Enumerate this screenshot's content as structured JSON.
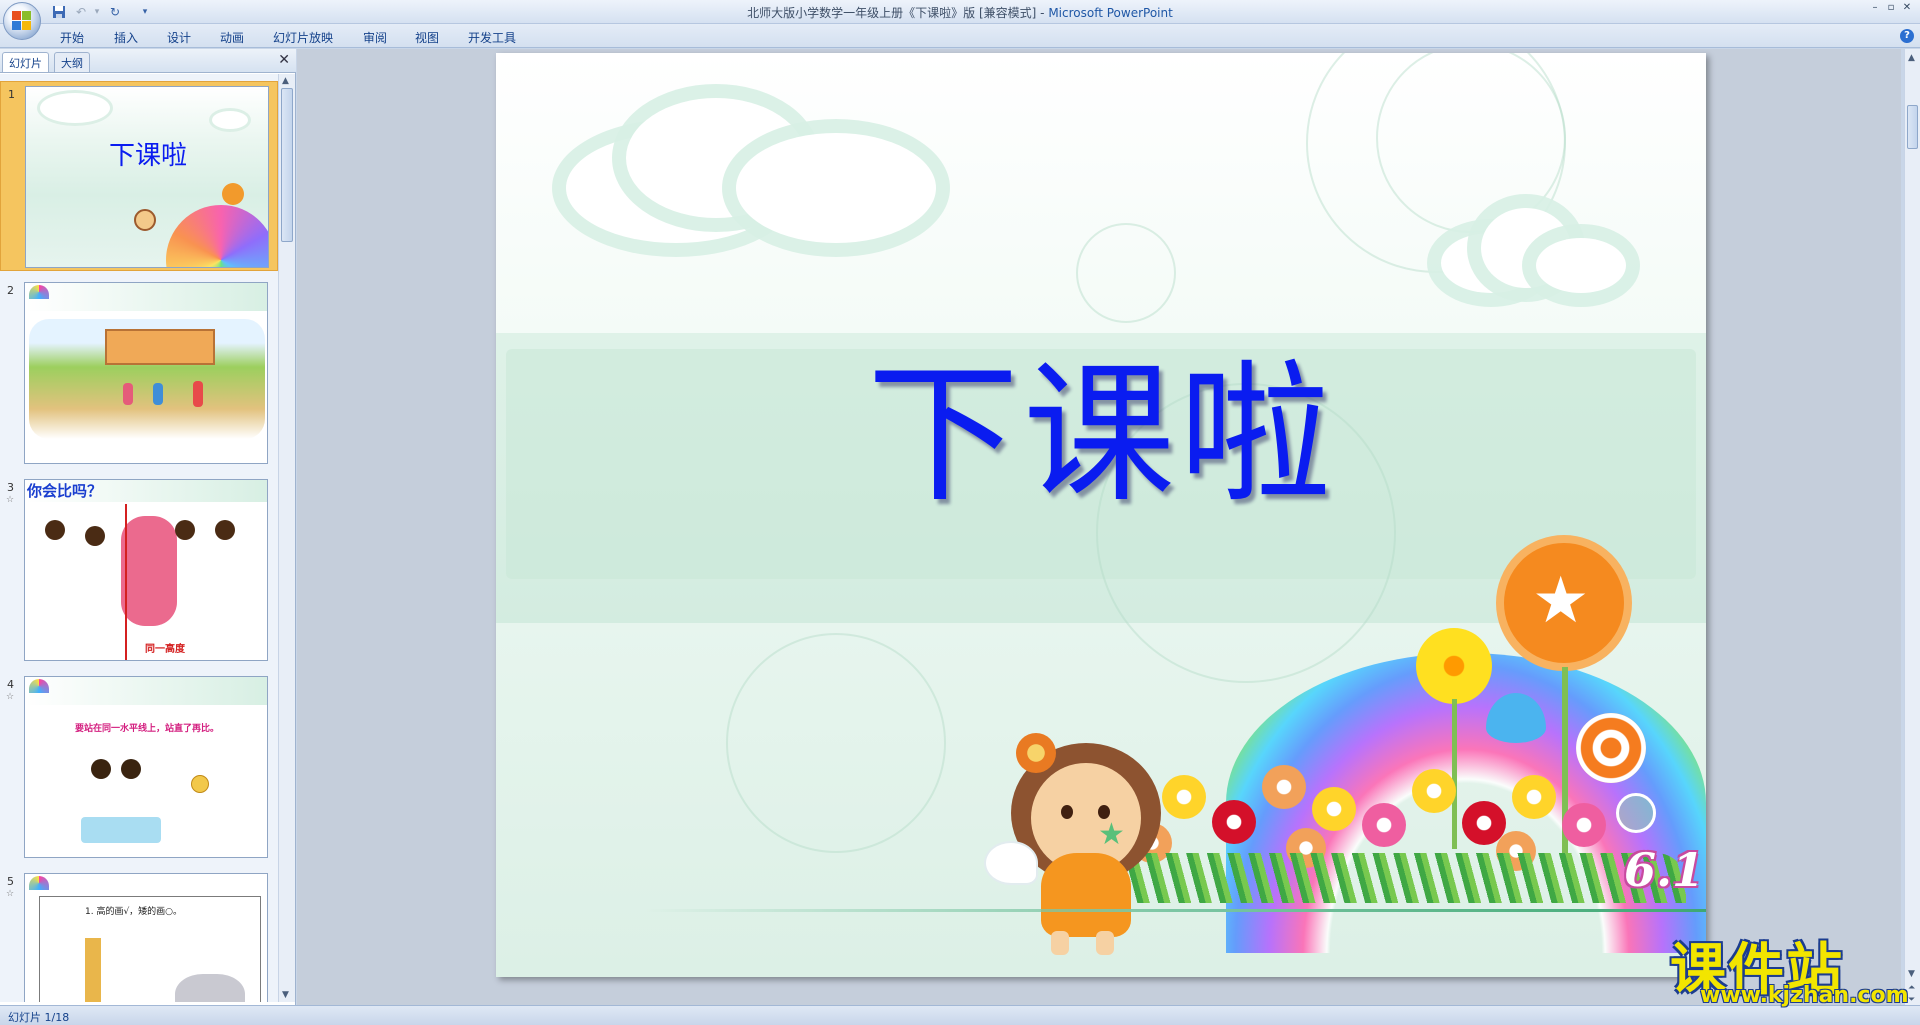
{
  "window": {
    "title_prefix": "北师大版小学数学一年级上册《下课啦》版 [兼容模式] - ",
    "title_app": "Microsoft PowerPoint"
  },
  "ribbon": {
    "tabs": [
      "开始",
      "插入",
      "设计",
      "动画",
      "幻灯片放映",
      "审阅",
      "视图",
      "开发工具"
    ]
  },
  "left_panel": {
    "tab_slides": "幻灯片",
    "tab_outline": "大纲",
    "close": "✕"
  },
  "thumbnails": [
    {
      "number": "1",
      "title": "下课啦"
    },
    {
      "number": "2"
    },
    {
      "number": "3",
      "title": "你会比吗？",
      "caption": "同一高度"
    },
    {
      "number": "4",
      "caption": "要站在同一水平线上，站直了再比。"
    },
    {
      "number": "5",
      "caption": "1. 高的画√，矮的画○。"
    }
  ],
  "slide": {
    "title": "下课啦",
    "badge": "6.1"
  },
  "status": {
    "slide_counter": "幻灯片 1/18"
  },
  "watermark": {
    "text": "课件站",
    "url": "www.kjzhan.com"
  },
  "colors": {
    "title_blue": "#0a1cf0",
    "selected_thumb": "#f5c55f",
    "watermark_yellow": "#f2e500"
  }
}
